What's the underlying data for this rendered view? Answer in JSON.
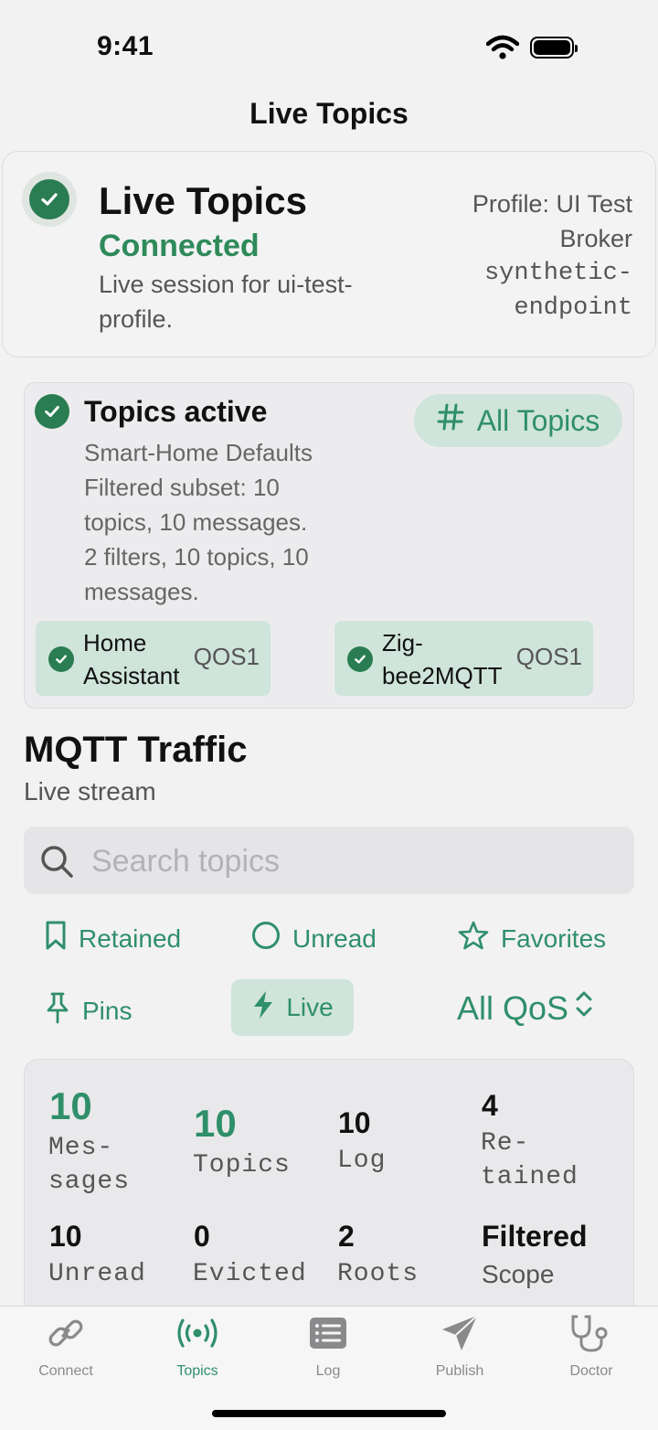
{
  "status_bar": {
    "time": "9:41"
  },
  "nav": {
    "title": "Live Topics"
  },
  "header": {
    "title": "Live Topics",
    "status": "Connected",
    "description": "Live session for ui-test-profile.",
    "profile": "Profile: UI Test Broker",
    "endpoint": "synthetic-endpoint"
  },
  "topics_card": {
    "title": "Topics active",
    "preset": "Smart-Home Defaults",
    "subset": "Filtered subset: 10 topics, 10 messages.",
    "summary": "2 filters, 10 topics, 10 messages.",
    "all_topics_label": "All Topics",
    "chips": [
      {
        "label": "Home Assistant",
        "qos": "QOS1"
      },
      {
        "label": "Zig-bee2MQTT",
        "qos": "QOS1"
      }
    ]
  },
  "traffic": {
    "title": "MQTT Traffic",
    "subtitle": "Live stream"
  },
  "search": {
    "placeholder": "Search topics",
    "value": ""
  },
  "filters": {
    "retained": "Retained",
    "unread": "Unread",
    "favorites": "Favorites",
    "pins": "Pins",
    "live": "Live",
    "qos": "All QoS"
  },
  "stats": {
    "messages": {
      "value": "10",
      "label": "Mes-sages"
    },
    "topics": {
      "value": "10",
      "label": "Topics"
    },
    "log": {
      "value": "10",
      "label": "Log"
    },
    "retained": {
      "value": "4",
      "label": "Re-tained"
    },
    "unread": {
      "value": "10",
      "label": "Unread"
    },
    "evicted": {
      "value": "0",
      "label": "Evicted"
    },
    "roots": {
      "value": "2",
      "label": "Roots"
    },
    "scope": {
      "value": "Filtered",
      "label": "Scope"
    }
  },
  "tabs": {
    "connect": "Connect",
    "topics": "Topics",
    "log": "Log",
    "publish": "Publish",
    "doctor": "Doctor"
  },
  "colors": {
    "accent": "#2f8f6a",
    "chip_bg": "#cfe4da",
    "check": "#2a7d52"
  }
}
